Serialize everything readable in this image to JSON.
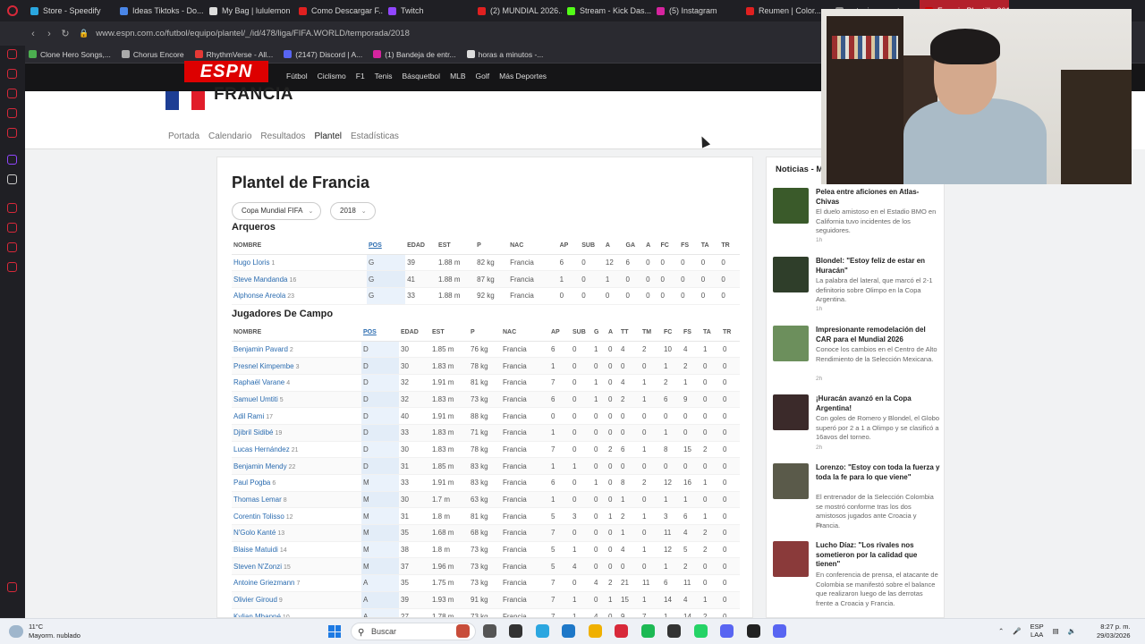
{
  "browser": {
    "tabs": [
      {
        "label": "Store - Speedify",
        "color": "#2aa7e0"
      },
      {
        "label": "Ideas Tiktoks - Do...",
        "color": "#4a86e8"
      },
      {
        "label": "My Bag | lululemon",
        "color": "#dddddd"
      },
      {
        "label": "Como Descargar F...",
        "color": "#e02020"
      },
      {
        "label": "Twitch",
        "color": "#9146ff"
      },
      {
        "label": "(2) MUNDIAL 2026...",
        "color": "#e02020"
      },
      {
        "label": "Stream - Kick Das...",
        "color": "#53fc18"
      },
      {
        "label": "(5) Instagram",
        "color": "#d6249f"
      },
      {
        "label": "Reumen | Color...",
        "color": "#e02020"
      },
      {
        "label": "estaciones catego...",
        "color": "#888888"
      },
      {
        "label": "Francia Plantilla 2018 - Fútbol",
        "color": "#d00000"
      }
    ],
    "url": "www.espn.com.co/futbol/equipo/plantel/_/id/478/liga/FIFA.WORLD/temporada/2018",
    "bookmarks": [
      {
        "label": "Clone Hero Songs,...",
        "color": "#4caf50"
      },
      {
        "label": "Chorus Encore",
        "color": "#aaaaaa"
      },
      {
        "label": "RhythmVerse - All...",
        "color": "#e53935"
      },
      {
        "label": "(2147) Discord | A...",
        "color": "#5865f2"
      },
      {
        "label": "(1) Bandeja de entr...",
        "color": "#d6249f"
      },
      {
        "label": "horas a minutos -...",
        "color": "#dddddd"
      }
    ]
  },
  "espn": {
    "logo": "ESPN",
    "sports": [
      "Fútbol",
      "Ciclismo",
      "F1",
      "Tenis",
      "Básquetbol",
      "MLB",
      "Golf",
      "Más Deportes"
    ]
  },
  "team": {
    "name": "FRANCIA",
    "nav": [
      "Portada",
      "Calendario",
      "Resultados",
      "Plantel",
      "Estadísticas"
    ],
    "active_nav": "Plantel"
  },
  "roster": {
    "title": "Plantel de Francia",
    "league_filter": "Copa Mundial FIFA",
    "season_filter": "2018",
    "goalkeepers": {
      "title": "Arqueros",
      "columns": [
        "NOMBRE",
        "POS",
        "EDAD",
        "EST",
        "P",
        "NAC",
        "AP",
        "SUB",
        "A",
        "GA",
        "A",
        "FC",
        "FS",
        "TA",
        "TR"
      ],
      "rows": [
        [
          "Hugo Lloris",
          "1",
          "G",
          "39",
          "1.88 m",
          "82 kg",
          "Francia",
          "6",
          "0",
          "12",
          "6",
          "0",
          "0",
          "0",
          "0",
          "0"
        ],
        [
          "Steve Mandanda",
          "16",
          "G",
          "41",
          "1.88 m",
          "87 kg",
          "Francia",
          "1",
          "0",
          "1",
          "0",
          "0",
          "0",
          "0",
          "0",
          "0"
        ],
        [
          "Alphonse Areola",
          "23",
          "G",
          "33",
          "1.88 m",
          "92 kg",
          "Francia",
          "0",
          "0",
          "0",
          "0",
          "0",
          "0",
          "0",
          "0",
          "0"
        ]
      ]
    },
    "field": {
      "title": "Jugadores De Campo",
      "columns": [
        "NOMBRE",
        "POS",
        "EDAD",
        "EST",
        "P",
        "NAC",
        "AP",
        "SUB",
        "G",
        "A",
        "TT",
        "TM",
        "FC",
        "FS",
        "TA",
        "TR"
      ],
      "rows": [
        [
          "Benjamin Pavard",
          "2",
          "D",
          "30",
          "1.85 m",
          "76 kg",
          "Francia",
          "6",
          "0",
          "1",
          "0",
          "4",
          "2",
          "10",
          "4",
          "1",
          "0"
        ],
        [
          "Presnel Kimpembe",
          "3",
          "D",
          "30",
          "1.83 m",
          "78 kg",
          "Francia",
          "1",
          "0",
          "0",
          "0",
          "0",
          "0",
          "1",
          "2",
          "0",
          "0"
        ],
        [
          "Raphaël Varane",
          "4",
          "D",
          "32",
          "1.91 m",
          "81 kg",
          "Francia",
          "7",
          "0",
          "1",
          "0",
          "4",
          "1",
          "2",
          "1",
          "0",
          "0"
        ],
        [
          "Samuel Umtiti",
          "5",
          "D",
          "32",
          "1.83 m",
          "73 kg",
          "Francia",
          "6",
          "0",
          "1",
          "0",
          "2",
          "1",
          "6",
          "9",
          "0",
          "0"
        ],
        [
          "Adil Rami",
          "17",
          "D",
          "40",
          "1.91 m",
          "88 kg",
          "Francia",
          "0",
          "0",
          "0",
          "0",
          "0",
          "0",
          "0",
          "0",
          "0",
          "0"
        ],
        [
          "Djibril Sidibé",
          "19",
          "D",
          "33",
          "1.83 m",
          "71 kg",
          "Francia",
          "1",
          "0",
          "0",
          "0",
          "0",
          "0",
          "1",
          "0",
          "0",
          "0"
        ],
        [
          "Lucas Hernández",
          "21",
          "D",
          "30",
          "1.83 m",
          "78 kg",
          "Francia",
          "7",
          "0",
          "0",
          "2",
          "6",
          "1",
          "8",
          "15",
          "2",
          "0"
        ],
        [
          "Benjamin Mendy",
          "22",
          "D",
          "31",
          "1.85 m",
          "83 kg",
          "Francia",
          "1",
          "1",
          "0",
          "0",
          "0",
          "0",
          "0",
          "0",
          "0",
          "0"
        ],
        [
          "Paul Pogba",
          "6",
          "M",
          "33",
          "1.91 m",
          "83 kg",
          "Francia",
          "6",
          "0",
          "1",
          "0",
          "8",
          "2",
          "12",
          "16",
          "1",
          "0"
        ],
        [
          "Thomas Lemar",
          "8",
          "M",
          "30",
          "1.7 m",
          "63 kg",
          "Francia",
          "1",
          "0",
          "0",
          "0",
          "1",
          "0",
          "1",
          "1",
          "0",
          "0"
        ],
        [
          "Corentin Tolisso",
          "12",
          "M",
          "31",
          "1.8 m",
          "81 kg",
          "Francia",
          "5",
          "3",
          "0",
          "1",
          "2",
          "1",
          "3",
          "6",
          "1",
          "0"
        ],
        [
          "N'Golo Kanté",
          "13",
          "M",
          "35",
          "1.68 m",
          "68 kg",
          "Francia",
          "7",
          "0",
          "0",
          "0",
          "1",
          "0",
          "11",
          "4",
          "2",
          "0"
        ],
        [
          "Blaise Matuidi",
          "14",
          "M",
          "38",
          "1.8 m",
          "73 kg",
          "Francia",
          "5",
          "1",
          "0",
          "0",
          "4",
          "1",
          "12",
          "5",
          "2",
          "0"
        ],
        [
          "Steven N'Zonzi",
          "15",
          "M",
          "37",
          "1.96 m",
          "73 kg",
          "Francia",
          "5",
          "4",
          "0",
          "0",
          "0",
          "0",
          "1",
          "2",
          "0",
          "0"
        ],
        [
          "Antoine Griezmann",
          "7",
          "A",
          "35",
          "1.75 m",
          "73 kg",
          "Francia",
          "7",
          "0",
          "4",
          "2",
          "21",
          "11",
          "6",
          "11",
          "0",
          "0"
        ],
        [
          "Olivier Giroud",
          "9",
          "A",
          "39",
          "1.93 m",
          "91 kg",
          "Francia",
          "7",
          "1",
          "0",
          "1",
          "15",
          "1",
          "14",
          "4",
          "1",
          "0"
        ],
        [
          "Kylian Mbappé",
          "10",
          "A",
          "27",
          "1.78 m",
          "73 kg",
          "Francia",
          "7",
          "1",
          "4",
          "0",
          "9",
          "7",
          "1",
          "14",
          "2",
          "0"
        ]
      ]
    }
  },
  "news": {
    "title": "Noticias - Mundial",
    "items": [
      {
        "headline": "Pelea entre aficiones en Atlas-Chivas",
        "body": "El duelo amistoso en el Estadio BMO en California tuvo incidentes de los seguidores.",
        "time": "1h",
        "thumb": "#3a5a2a"
      },
      {
        "headline": "Blondel: \"Estoy feliz de estar en Huracán\"",
        "body": "La palabra del lateral, que marcó el 2-1 definitorio sobre Olimpo en la Copa Argentina.",
        "time": "1h",
        "thumb": "#2f3e2a"
      },
      {
        "headline": "Impresionante remodelación del CAR para el Mundial 2026",
        "body": "Conoce los cambios en el Centro de Alto Rendimiento de la Selección Mexicana.",
        "time": "2h",
        "thumb": "#6c8f5c"
      },
      {
        "headline": "¡Huracán avanzó en la Copa Argentina!",
        "body": "Con goles de Romero y Blondel, el Globo superó por 2 a 1 a Olimpo y se clasificó a 16avos del torneo.",
        "time": "2h",
        "thumb": "#3b2a2a"
      },
      {
        "headline": "Lorenzo: \"Estoy con toda la fuerza y toda la fe para lo que viene\"",
        "body": "El entrenador de la Selección Colombia se mostró conforme tras los dos amistosos jugados ante Croacia y Francia.",
        "time": "2h",
        "thumb": "#5a5a4a"
      },
      {
        "headline": "Lucho Díaz: \"Los rivales nos sometieron por la calidad que tienen\"",
        "body": "En conferencia de prensa, el atacante de Colombia se manifestó sobre el balance que realizaron luego de las derrotas frente a Croacia y Francia.",
        "time": "",
        "thumb": "#8a3a3a"
      }
    ]
  },
  "taskbar": {
    "temp": "11°C",
    "weather": "Mayorm. nublado",
    "search": "Buscar",
    "lang1": "ESP",
    "lang2": "LAA",
    "time": "8:27 p. m.",
    "date": "29/03/2026",
    "apps": [
      "#c84d3a",
      "#555555",
      "#333333",
      "#2ba6e0",
      "#1e78c8",
      "#f0b000",
      "#d8293a",
      "#1db954",
      "#333333",
      "#25d366",
      "#5865f2",
      "#222222",
      "#5865f2"
    ]
  }
}
